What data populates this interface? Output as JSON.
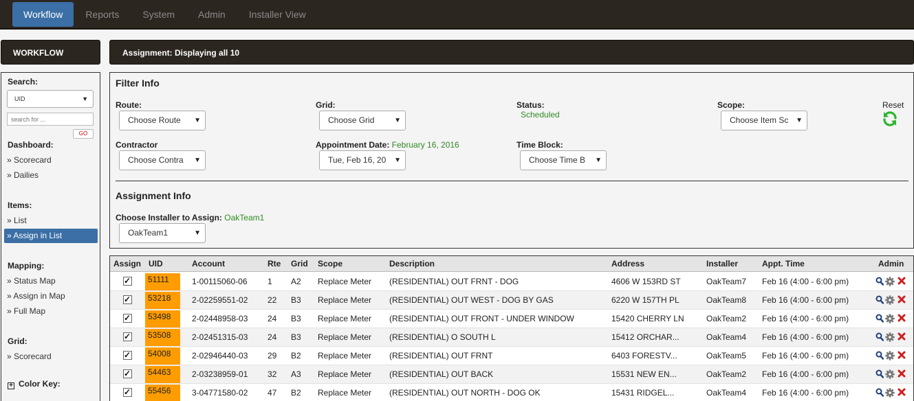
{
  "nav": {
    "tabs": [
      {
        "label": "Workflow",
        "active": true
      },
      {
        "label": "Reports"
      },
      {
        "label": "System"
      },
      {
        "label": "Admin"
      },
      {
        "label": "Installer View"
      }
    ]
  },
  "sidebar": {
    "header": "WORKFLOW",
    "search_label": "Search:",
    "search_type": "UID",
    "search_placeholder": "search for ...",
    "go_label": "GO",
    "dashboard_label": "Dashboard:",
    "dashboard_links": [
      "» Scorecard",
      "» Dailies"
    ],
    "items_label": "Items:",
    "items_links": [
      "» List",
      "» Assign in List"
    ],
    "mapping_label": "Mapping:",
    "mapping_links": [
      "» Status Map",
      "» Assign in Map",
      "» Full Map"
    ],
    "grid_label": "Grid:",
    "grid_links": [
      "» Scorecard"
    ],
    "color_key_label": "Color Key:"
  },
  "main": {
    "header": "Assignment: Displaying all 10",
    "filter": {
      "title": "Filter Info",
      "route_label": "Route:",
      "route_value": "Choose Route",
      "grid_label": "Grid:",
      "grid_value": "Choose Grid",
      "status_label": "Status:",
      "status_value": "Scheduled",
      "scope_label": "Scope:",
      "scope_value": "Choose Item Sc",
      "reset_label": "Reset",
      "contractor_label": "Contractor",
      "contractor_value": "Choose Contra",
      "appt_label": "Appointment Date:",
      "appt_value_text": "February 16, 2016",
      "appt_select": "Tue, Feb 16, 20",
      "timeblock_label": "Time Block:",
      "timeblock_value": "Choose Time B"
    },
    "assignment": {
      "title": "Assignment Info",
      "installer_label": "Choose Installer to Assign:",
      "installer_value_text": "OakTeam1",
      "installer_select": "OakTeam1"
    }
  },
  "table": {
    "headers": [
      "Assign",
      "UID",
      "Account",
      "Rte",
      "Grid",
      "Scope",
      "Description",
      "Address",
      "Installer",
      "Appt. Time",
      "Admin"
    ],
    "rows": [
      {
        "uid": "51111",
        "account": "1-00115060-06",
        "rte": "1",
        "grid": "A2",
        "scope": "Replace Meter",
        "description": "(RESIDENTIAL) OUT FRNT - DOG",
        "address": "4606 W 153RD ST",
        "installer": "OakTeam7",
        "appt": "Feb 16 (4:00 - 6:00 pm)"
      },
      {
        "uid": "53218",
        "account": "2-02259551-02",
        "rte": "22",
        "grid": "B3",
        "scope": "Replace Meter",
        "description": "(RESIDENTIAL) OUT WEST - DOG BY GAS",
        "address": "6220 W 157TH PL",
        "installer": "OakTeam8",
        "appt": "Feb 16 (4:00 - 6:00 pm)"
      },
      {
        "uid": "53498",
        "account": "2-02448958-03",
        "rte": "24",
        "grid": "B3",
        "scope": "Replace Meter",
        "description": "(RESIDENTIAL) OUT FRONT - UNDER WINDOW",
        "address": "15420 CHERRY LN",
        "installer": "OakTeam2",
        "appt": "Feb 16 (4:00 - 6:00 pm)"
      },
      {
        "uid": "53508",
        "account": "2-02451315-03",
        "rte": "24",
        "grid": "B3",
        "scope": "Replace Meter",
        "description": "(RESIDENTIAL) O SOUTH L",
        "address": "15412 ORCHAR...",
        "installer": "OakTeam4",
        "appt": "Feb 16 (4:00 - 6:00 pm)"
      },
      {
        "uid": "54008",
        "account": "2-02946440-03",
        "rte": "29",
        "grid": "B2",
        "scope": "Replace Meter",
        "description": "(RESIDENTIAL) OUT FRNT",
        "address": "6403 FORESTV...",
        "installer": "OakTeam5",
        "appt": "Feb 16 (4:00 - 6:00 pm)"
      },
      {
        "uid": "54463",
        "account": "2-03238959-01",
        "rte": "32",
        "grid": "A3",
        "scope": "Replace Meter",
        "description": "(RESIDENTIAL) OUT BACK",
        "address": "15531 NEW EN...",
        "installer": "OakTeam2",
        "appt": "Feb 16 (4:00 - 6:00 pm)"
      },
      {
        "uid": "55456",
        "account": "3-04771580-02",
        "rte": "47",
        "grid": "B2",
        "scope": "Replace Meter",
        "description": "(RESIDENTIAL) OUT NORTH - DOG OK",
        "address": "15431 RIDGEL...",
        "installer": "OakTeam4",
        "appt": "Feb 16 (4:00 - 6:00 pm)"
      }
    ]
  },
  "colors": {
    "nav_bg": "#2c2620",
    "accent": "#3b6fa5",
    "uid_highlight": "#ff9c00",
    "status_green": "#2e8b20",
    "delete_red": "#cc1f1f"
  }
}
